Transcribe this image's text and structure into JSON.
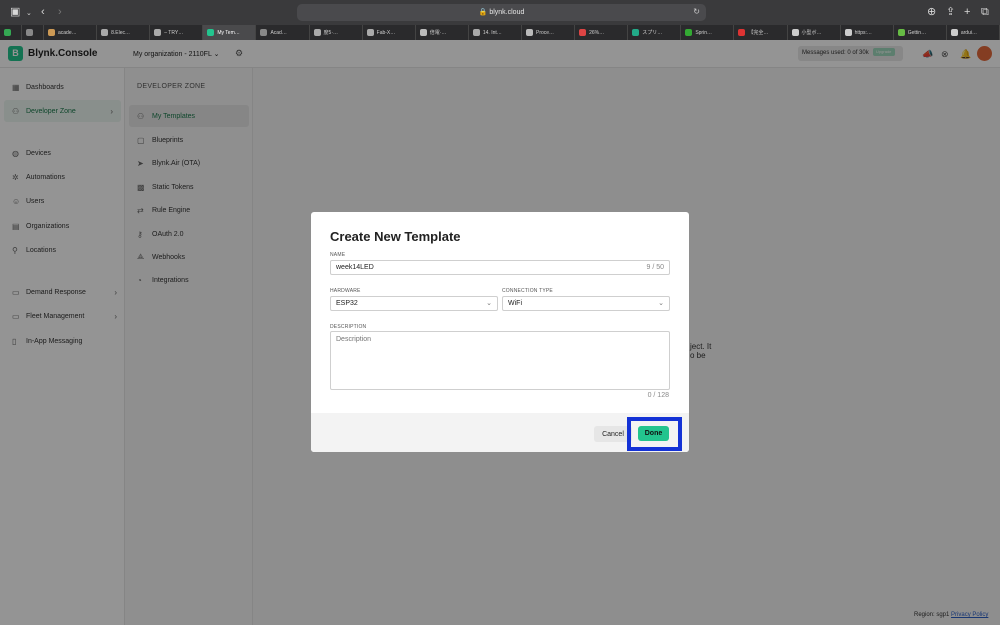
{
  "browser": {
    "url": "blynk.cloud",
    "tabs": [
      {
        "label": "",
        "pinned": true
      },
      {
        "label": "",
        "pinned": true
      },
      {
        "label": "acade…"
      },
      {
        "label": "8.Elec…"
      },
      {
        "label": "– TRY…"
      },
      {
        "label": "My Tem…",
        "active": true
      },
      {
        "label": "Acad…"
      },
      {
        "label": "度5·…"
      },
      {
        "label": "Fab-X…"
      },
      {
        "label": "倍電·…"
      },
      {
        "label": "14. Int…"
      },
      {
        "label": "Proce…"
      },
      {
        "label": "26%…"
      },
      {
        "label": "スプリ…"
      },
      {
        "label": "Sprin…"
      },
      {
        "label": "【完全…"
      },
      {
        "label": "小型ボ…"
      },
      {
        "label": "https:…"
      },
      {
        "label": "Gettin…"
      },
      {
        "label": "ardui…"
      }
    ]
  },
  "header": {
    "logo_letter": "B",
    "brand": "Blynk.Console",
    "org": "My organization - 2110FL",
    "messages": "Messages used: 0 of 30k",
    "upgrade": "Upgrade"
  },
  "sidebar": {
    "items": [
      {
        "label": "Dashboards",
        "icon": "grid-icon"
      },
      {
        "label": "Developer Zone",
        "icon": "devzone-icon",
        "active": true
      },
      {
        "label": "Devices",
        "icon": "devices-icon"
      },
      {
        "label": "Automations",
        "icon": "automation-icon"
      },
      {
        "label": "Users",
        "icon": "user-icon"
      },
      {
        "label": "Organizations",
        "icon": "org-icon"
      },
      {
        "label": "Locations",
        "icon": "location-icon"
      },
      {
        "label": "Demand Response",
        "icon": "demand-icon"
      },
      {
        "label": "Fleet Management",
        "icon": "fleet-icon"
      },
      {
        "label": "In-App Messaging",
        "icon": "message-icon"
      }
    ]
  },
  "devzone": {
    "title": "DEVELOPER ZONE",
    "items": [
      {
        "label": "My Templates",
        "active": true
      },
      {
        "label": "Blueprints"
      },
      {
        "label": "Blynk.Air (OTA)"
      },
      {
        "label": "Static Tokens"
      },
      {
        "label": "Rule Engine"
      },
      {
        "label": "OAuth 2.0"
      },
      {
        "label": "Webhooks"
      },
      {
        "label": "Integrations"
      }
    ]
  },
  "background": {
    "partial_line1": "ject. It",
    "partial_line2": "o be"
  },
  "footer": {
    "region": "Region: sgp1",
    "privacy": "Privacy Policy"
  },
  "modal": {
    "title": "Create New Template",
    "name_label": "NAME",
    "name_value": "week14LED",
    "name_count": "9 / 50",
    "hardware_label": "HARDWARE",
    "hardware_value": "ESP32",
    "connection_label": "CONNECTION TYPE",
    "connection_value": "WiFi",
    "description_label": "DESCRIPTION",
    "description_placeholder": "Description",
    "description_count": "0 / 128",
    "cancel": "Cancel",
    "done": "Done"
  }
}
